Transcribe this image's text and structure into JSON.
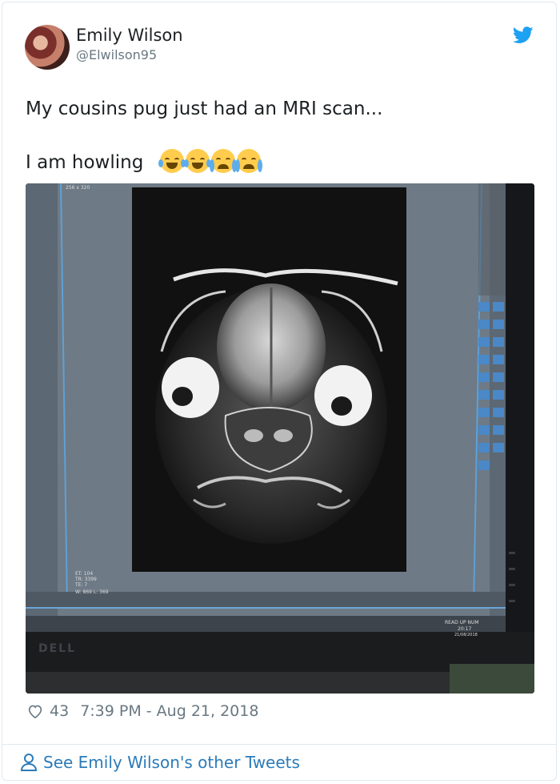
{
  "user": {
    "name": "Emily Wilson",
    "handle": "@Elwilson95"
  },
  "tweet": {
    "text_line1": "My cousins pug just had an MRI scan...",
    "text_line2": "I am howling",
    "emojis": [
      "face-with-tears-of-joy",
      "face-with-tears-of-joy",
      "loudly-crying-face",
      "loudly-crying-face"
    ]
  },
  "photo": {
    "description_icon": "mri-pug-scan-photo",
    "screen_labels": {
      "header": "256 x 320",
      "params1": "ET: 104",
      "params2": "TR: 3399",
      "params3": "TE: 7",
      "window": "W: 869  L: 369",
      "status": "READ UP NUM",
      "time": "20:17",
      "date": "21/08/2018",
      "brand": "DELL"
    }
  },
  "meta": {
    "likes": "43",
    "timestamp": "7:39 PM - Aug 21, 2018"
  },
  "footer": {
    "see_more": "See Emily Wilson's other Tweets"
  },
  "colors": {
    "link": "#2b7bb9",
    "twitter_blue": "#1da1f2",
    "muted": "#697882"
  }
}
